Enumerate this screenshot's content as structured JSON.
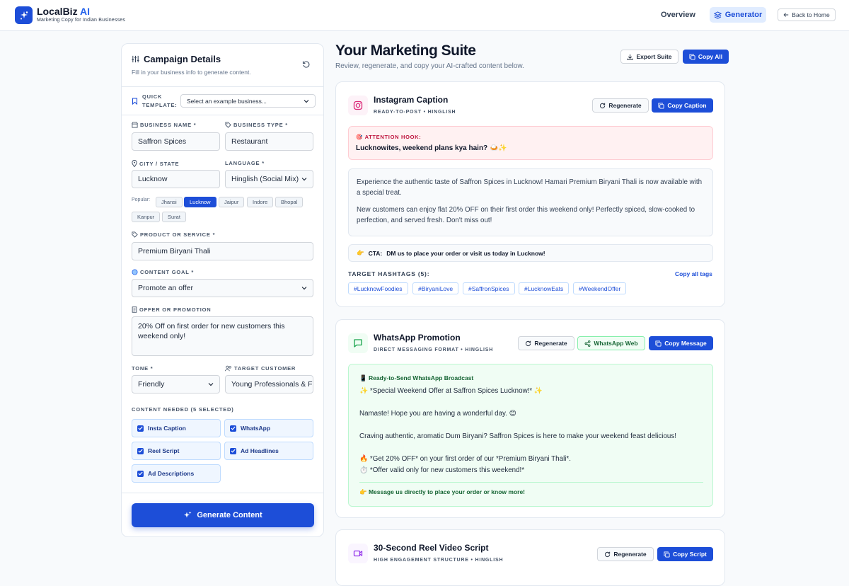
{
  "header": {
    "brand_name": "LocalBiz",
    "brand_ai": "AI",
    "brand_tagline": "Marketing Copy for Indian Businesses",
    "nav_overview": "Overview",
    "nav_generator": "Generator",
    "nav_back": "Back to Home"
  },
  "campaign": {
    "title": "Campaign Details",
    "subtitle": "Fill in your business info to generate content.",
    "quick_template_label_1": "QUICK",
    "quick_template_label_2": "TEMPLATE:",
    "quick_template_value": "Select an example business...",
    "business_name_label": "BUSINESS NAME *",
    "business_name_value": "Saffron Spices",
    "business_type_label": "BUSINESS TYPE *",
    "business_type_value": "Restaurant",
    "city_label": "CITY / STATE",
    "city_value": "Lucknow",
    "language_label": "LANGUAGE *",
    "language_value": "Hinglish (Social Mix)",
    "popular_label": "Popular:",
    "popular_cities": [
      "Jhansi",
      "Lucknow",
      "Jaipur",
      "Indore",
      "Bhopal",
      "Kanpur",
      "Surat"
    ],
    "product_label": "PRODUCT OR SERVICE *",
    "product_value": "Premium Biryani Thali",
    "goal_label": "CONTENT GOAL *",
    "goal_value": "Promote an offer",
    "offer_label": "OFFER OR PROMOTION",
    "offer_value": "20% Off on first order for new customers this weekend only!",
    "tone_label": "TONE *",
    "tone_value": "Friendly",
    "target_label": "TARGET CUSTOMER",
    "target_value": "Young Professionals & F",
    "content_needed_label": "CONTENT NEEDED (5 SELECTED)",
    "content_options": [
      "Insta Caption",
      "WhatsApp",
      "Reel Script",
      "Ad Headlines",
      "Ad Descriptions"
    ],
    "generate_label": "Generate Content"
  },
  "suite": {
    "title": "Your Marketing Suite",
    "subtitle": "Review, regenerate, and copy your AI-crafted content below.",
    "export_label": "Export Suite",
    "copy_all_label": "Copy All"
  },
  "instagram": {
    "title": "Instagram Caption",
    "subtitle": "READY-TO-POST • HINGLISH",
    "regenerate_label": "Regenerate",
    "copy_label": "Copy Caption",
    "hook_label": "ATTENTION HOOK:",
    "hook_text": "Lucknowites, weekend plans kya hain? 🍛✨",
    "body_1": "Experience the authentic taste of Saffron Spices in Lucknow! Hamari Premium Biryani Thali is now available with a special treat.",
    "body_2": "New customers can enjoy flat 20% OFF on their first order this weekend only! Perfectly spiced, slow-cooked to perfection, and served fresh. Don't miss out!",
    "cta_label": "CTA:",
    "cta_text": "DM us to place your order or visit us today in Lucknow!",
    "tags_label": "TARGET HASHTAGS (5):",
    "copy_tags_label": "Copy all tags",
    "hashtags": [
      "#LucknowFoodies",
      "#BiryaniLove",
      "#SaffronSpices",
      "#LucknowEats",
      "#WeekendOffer"
    ]
  },
  "whatsapp": {
    "title": "WhatsApp Promotion",
    "subtitle": "DIRECT MESSAGING FORMAT • HINGLISH",
    "regenerate_label": "Regenerate",
    "web_label": "WhatsApp Web",
    "copy_label": "Copy Message",
    "box_label": "Ready-to-Send WhatsApp Broadcast",
    "line_1": "✨ *Special Weekend Offer at Saffron Spices Lucknow!* ✨",
    "line_2": "Namaste! Hope you are having a wonderful day. 😊",
    "line_3": "Craving authentic, aromatic Dum Biryani? Saffron Spices is here to make your weekend feast delicious!",
    "line_4": "🔥 *Get 20% OFF* on your first order of our *Premium Biryani Thali*.",
    "line_5": "⏱️ *Offer valid only for new customers this weekend!*",
    "footer": "👉 Message us directly to place your order or know more!"
  },
  "reel": {
    "title": "30-Second Reel Video Script",
    "subtitle": "HIGH ENGAGEMENT STRUCTURE • HINGLISH",
    "regenerate_label": "Regenerate",
    "copy_label": "Copy Script"
  }
}
